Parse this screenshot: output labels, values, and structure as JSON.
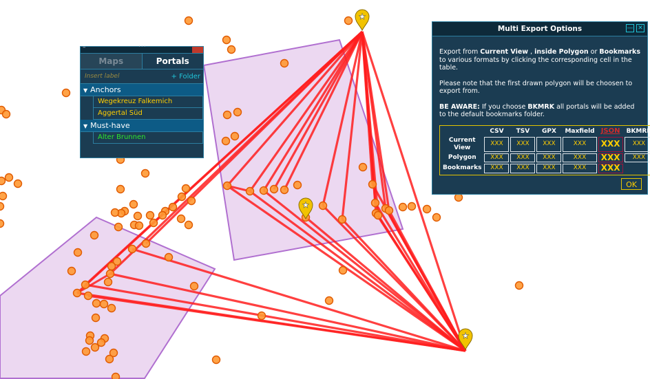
{
  "map": {
    "colors": {
      "polygon_fill": "#dcb8e6",
      "polygon_stroke": "#b06fd0",
      "link": "#ff1f1f",
      "portal_fill": "#ff9933",
      "portal_stroke": "#e05a00",
      "marker": "#f2c300"
    }
  },
  "bookmarks_panel": {
    "tabs": [
      "Maps",
      "Portals"
    ],
    "label_placeholder": "Insert label",
    "add_folder": "+ Folder",
    "folders": [
      {
        "name": "Anchors",
        "items": [
          {
            "label": "Wegekreuz Falkemich",
            "color": "#ffce00"
          },
          {
            "label": "Aggertal Süd",
            "color": "#ffce00"
          }
        ]
      },
      {
        "name": "Must-have",
        "items": [
          {
            "label": "Alter Brunnen",
            "color": "#2ee62e"
          }
        ]
      }
    ]
  },
  "export_dialog": {
    "title": "Multi Export Options",
    "min_icon": "—",
    "close_icon": "✕",
    "p1": [
      {
        "t": "Export from ",
        "b": false
      },
      {
        "t": "Current View",
        "b": true
      },
      {
        "t": " , ",
        "b": false
      },
      {
        "t": "inside Polygon",
        "b": true
      },
      {
        "t": " or ",
        "b": false
      },
      {
        "t": "Bookmarks",
        "b": true
      },
      {
        "t": " to various formats by clicking the corresponding cell in the table.",
        "b": false
      }
    ],
    "p2": "Please note that the first drawn polygon will be choosen to export from.",
    "p3": [
      {
        "t": "BE AWARE:",
        "b": true
      },
      {
        "t": " If you choose ",
        "b": false
      },
      {
        "t": "BKMRK",
        "b": true
      },
      {
        "t": " all portals will be added to the default bookmarks folder.",
        "b": false
      }
    ],
    "columns": [
      "CSV",
      "TSV",
      "GPX",
      "Maxfield",
      "JSON",
      "BKMRK"
    ],
    "rows": [
      {
        "label": "Current View",
        "cells": [
          "XXX",
          "XXX",
          "XXX",
          "XXX",
          "XXX",
          "XXX"
        ]
      },
      {
        "label": "Polygon",
        "cells": [
          "XXX",
          "XXX",
          "XXX",
          "XXX",
          "XXX",
          "XXX"
        ]
      },
      {
        "label": "Bookmarks",
        "cells": [
          "XXX",
          "XXX",
          "XXX",
          "XXX",
          "XXX",
          ""
        ]
      }
    ],
    "ok_label": "OK"
  }
}
